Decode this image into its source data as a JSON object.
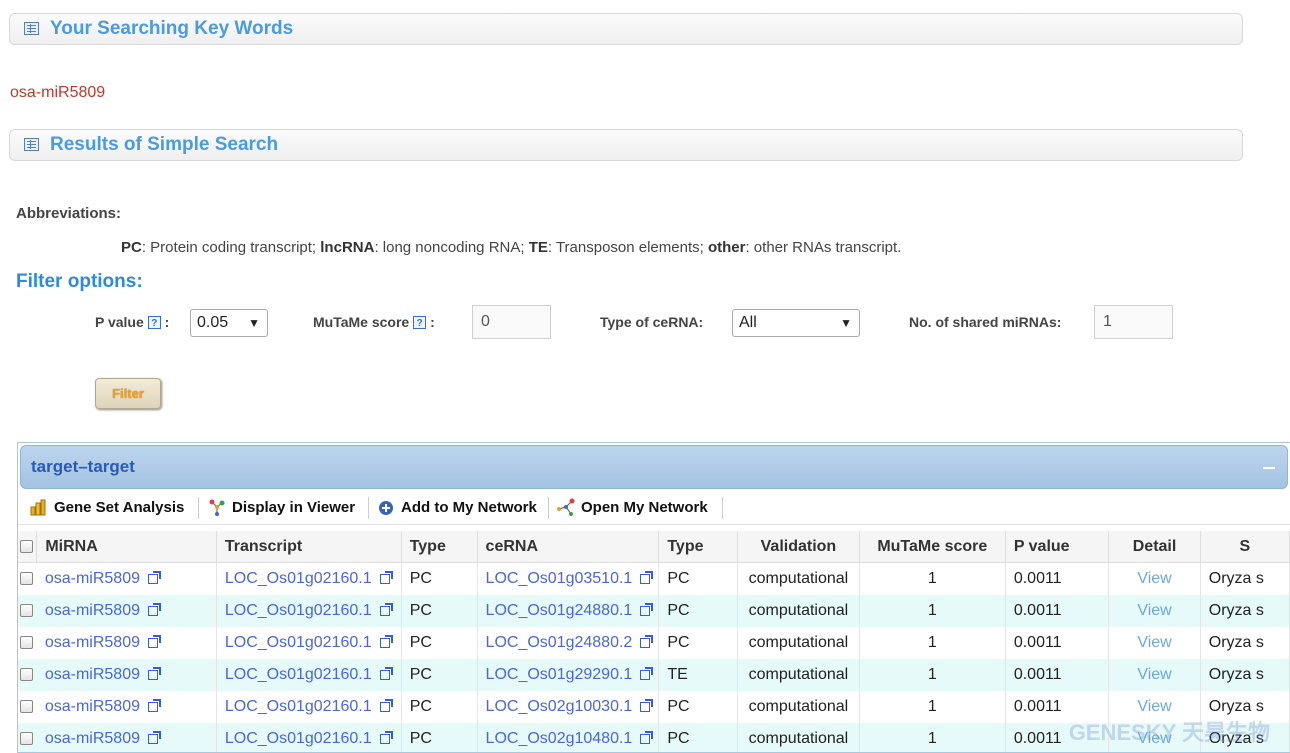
{
  "sections": {
    "keywords_title": "Your Searching Key Words",
    "keyword_value": "osa-miR5809",
    "results_title": "Results of Simple Search"
  },
  "abbreviations": {
    "title": "Abbreviations:",
    "pc_key": "PC",
    "pc_text": ": Protein coding transcript; ",
    "lnc_key": "lncRNA",
    "lnc_text": ": long noncoding RNA; ",
    "te_key": "TE",
    "te_text": ": Transposon elements; ",
    "other_key": "other",
    "other_text": ": other RNAs transcript."
  },
  "filter": {
    "title": "Filter options:",
    "pvalue_label": "P value",
    "pvalue_value": "0.05",
    "mutame_label": "MuTaMe score",
    "mutame_value": "0",
    "type_label": "Type of ceRNA:",
    "type_value": "All",
    "shared_label": "No. of shared miRNAs:",
    "shared_value": "1",
    "button_label": "Filter",
    "help_glyph": "?",
    "colon": ":",
    "dropdown_glyph": "▼"
  },
  "grid": {
    "title": "target–target",
    "toolbar": {
      "gene_set": "Gene Set Analysis",
      "display_viewer": "Display in Viewer",
      "add_network": "Add to My Network",
      "open_network": "Open My Network"
    },
    "columns": [
      "MiRNA",
      "Transcript",
      "Type",
      "ceRNA",
      "Type",
      "Validation",
      "MuTaMe score",
      "P value",
      "Detail",
      "S"
    ],
    "rows": [
      [
        "osa-miR5809",
        "LOC_Os01g02160.1",
        "PC",
        "LOC_Os01g03510.1",
        "PC",
        "computational",
        "1",
        "0.0011",
        "View",
        "Oryza s"
      ],
      [
        "osa-miR5809",
        "LOC_Os01g02160.1",
        "PC",
        "LOC_Os01g24880.1",
        "PC",
        "computational",
        "1",
        "0.0011",
        "View",
        "Oryza s"
      ],
      [
        "osa-miR5809",
        "LOC_Os01g02160.1",
        "PC",
        "LOC_Os01g24880.2",
        "PC",
        "computational",
        "1",
        "0.0011",
        "View",
        "Oryza s"
      ],
      [
        "osa-miR5809",
        "LOC_Os01g02160.1",
        "PC",
        "LOC_Os01g29290.1",
        "TE",
        "computational",
        "1",
        "0.0011",
        "View",
        "Oryza s"
      ],
      [
        "osa-miR5809",
        "LOC_Os01g02160.1",
        "PC",
        "LOC_Os02g10030.1",
        "PC",
        "computational",
        "1",
        "0.0011",
        "View",
        "Oryza s"
      ],
      [
        "osa-miR5809",
        "LOC_Os01g02160.1",
        "PC",
        "LOC_Os02g10480.1",
        "PC",
        "computational",
        "1",
        "0.0011",
        "View",
        "Oryza s"
      ]
    ]
  },
  "watermark": "GENESKY 天昊生物",
  "colors": {
    "heading": "#4a9be0",
    "keyword": "#c0392b",
    "link": "#4a66d8",
    "alt_row": "#e6fafa",
    "grid_caption": "#a3c3e2"
  }
}
